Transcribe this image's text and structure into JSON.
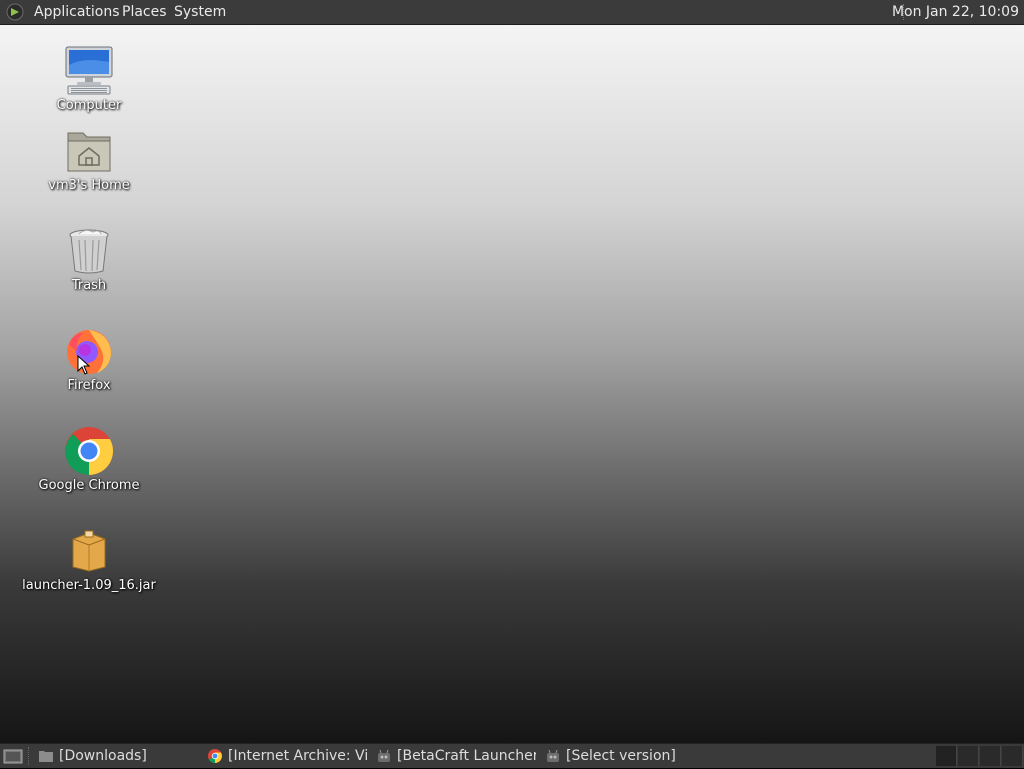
{
  "top_panel": {
    "menus": [
      "Applications",
      "Places",
      "System"
    ],
    "clock": "Mon Jan 22, 10:09"
  },
  "desktop": {
    "icons": [
      {
        "label": "Computer",
        "icon": "computer-icon"
      },
      {
        "label": "vm3's Home",
        "icon": "home-folder-icon"
      },
      {
        "label": "Trash",
        "icon": "trash-icon"
      },
      {
        "label": "Firefox",
        "icon": "firefox-icon"
      },
      {
        "label": "Google Chrome",
        "icon": "chrome-icon"
      },
      {
        "label": "launcher-1.09_16.jar",
        "icon": "jar-package-icon"
      }
    ]
  },
  "taskbar": {
    "tasks": [
      {
        "label": "[Downloads]",
        "icon": "folder-icon"
      },
      {
        "label": "[Internet Archive: Vi...",
        "icon": "chrome-icon"
      },
      {
        "label": "[BetaCraft Launcher...",
        "icon": "java-icon"
      },
      {
        "label": "[Select version]",
        "icon": "java-icon"
      }
    ]
  },
  "colors": {
    "panel_bg": "#3b3b3b",
    "panel_text": "#eaeaea",
    "desktop_top": "#f4f4f4",
    "desktop_bottom": "#151515"
  }
}
